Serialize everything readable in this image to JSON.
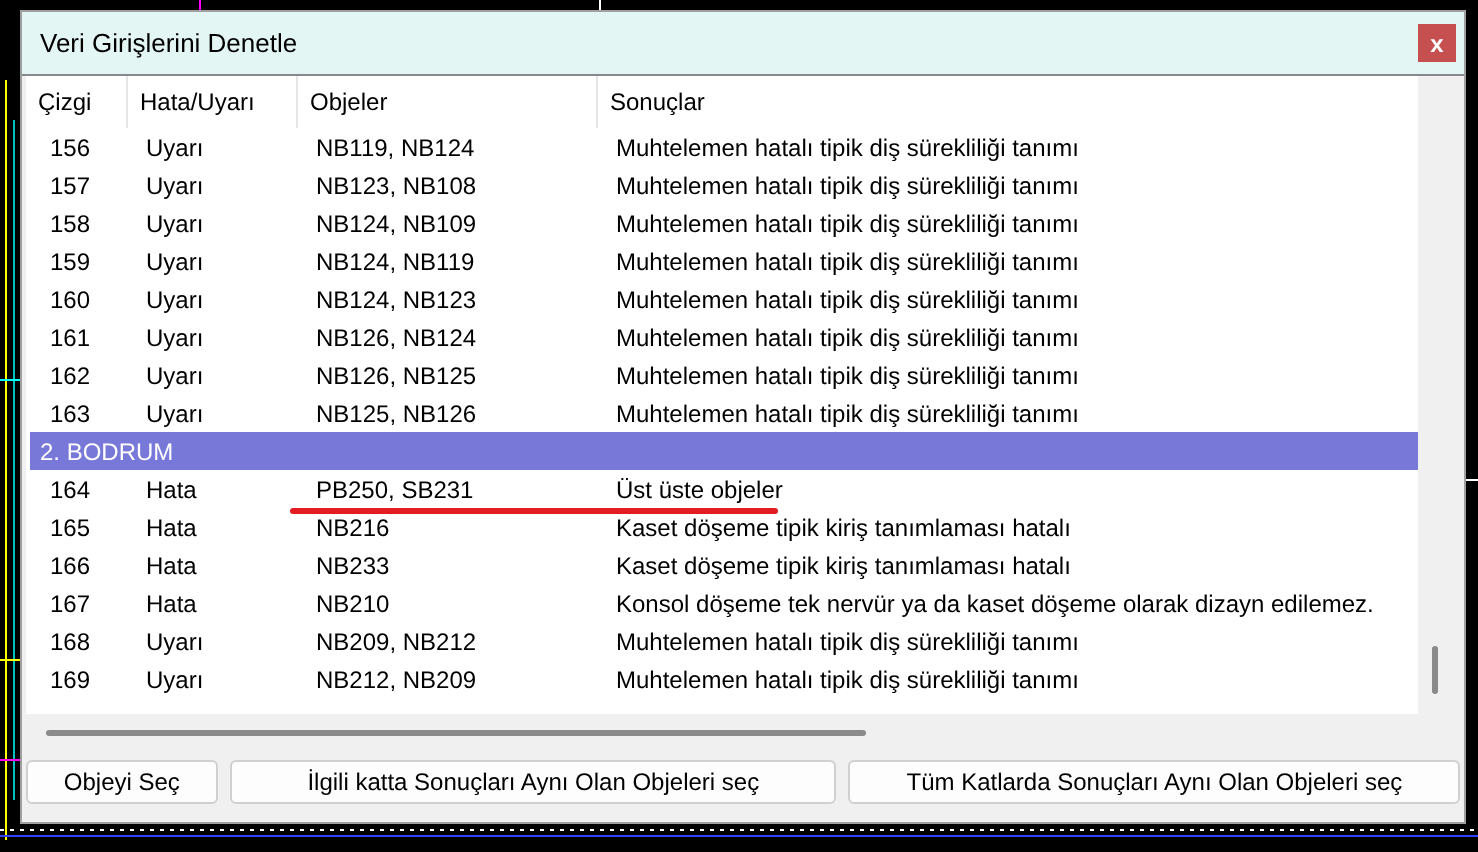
{
  "window": {
    "title": "Veri Girişlerini Denetle",
    "close": "x"
  },
  "table": {
    "columns": [
      "Çizgi",
      "Hata/Uyarı",
      "Objeler",
      "Sonuçlar"
    ],
    "rows": [
      {
        "kind": "row",
        "cells": [
          "156",
          "Uyarı",
          "NB119, NB124",
          "Muhtelemen hatalı tipik diş sürekliliği tanımı"
        ]
      },
      {
        "kind": "row",
        "cells": [
          "157",
          "Uyarı",
          "NB123, NB108",
          "Muhtelemen hatalı tipik diş sürekliliği tanımı"
        ]
      },
      {
        "kind": "row",
        "cells": [
          "158",
          "Uyarı",
          "NB124, NB109",
          "Muhtelemen hatalı tipik diş sürekliliği tanımı"
        ]
      },
      {
        "kind": "row",
        "cells": [
          "159",
          "Uyarı",
          "NB124, NB119",
          "Muhtelemen hatalı tipik diş sürekliliği tanımı"
        ]
      },
      {
        "kind": "row",
        "cells": [
          "160",
          "Uyarı",
          "NB124, NB123",
          "Muhtelemen hatalı tipik diş sürekliliği tanımı"
        ]
      },
      {
        "kind": "row",
        "cells": [
          "161",
          "Uyarı",
          "NB126, NB124",
          "Muhtelemen hatalı tipik diş sürekliliği tanımı"
        ]
      },
      {
        "kind": "row",
        "cells": [
          "162",
          "Uyarı",
          "NB126, NB125",
          "Muhtelemen hatalı tipik diş sürekliliği tanımı"
        ]
      },
      {
        "kind": "row",
        "cells": [
          "163",
          "Uyarı",
          "NB125, NB126",
          "Muhtelemen hatalı tipik diş sürekliliği tanımı"
        ]
      },
      {
        "kind": "group",
        "label": "2. BODRUM"
      },
      {
        "kind": "row",
        "underlined": true,
        "cells": [
          "164",
          "Hata",
          "PB250, SB231",
          "Üst üste objeler"
        ]
      },
      {
        "kind": "row",
        "cells": [
          "165",
          "Hata",
          "NB216",
          "Kaset döşeme tipik kiriş tanımlaması hatalı"
        ]
      },
      {
        "kind": "row",
        "cells": [
          "166",
          "Hata",
          "NB233",
          "Kaset döşeme tipik kiriş tanımlaması hatalı"
        ]
      },
      {
        "kind": "row",
        "cells": [
          "167",
          "Hata",
          "NB210",
          "Konsol döşeme tek nervür ya da kaset döşeme olarak dizayn edilemez."
        ]
      },
      {
        "kind": "row",
        "cells": [
          "168",
          "Uyarı",
          "NB209, NB212",
          "Muhtelemen hatalı tipik diş sürekliliği tanımı"
        ]
      },
      {
        "kind": "row",
        "cells": [
          "169",
          "Uyarı",
          "NB212, NB209",
          "Muhtelemen hatalı tipik diş sürekliliği tanımı"
        ]
      }
    ]
  },
  "buttons": [
    "Objeyi Seç",
    "İlgili katta Sonuçları Aynı Olan Objeleri seç",
    "Tüm Katlarda Sonuçları Aynı Olan Objeleri seç"
  ]
}
